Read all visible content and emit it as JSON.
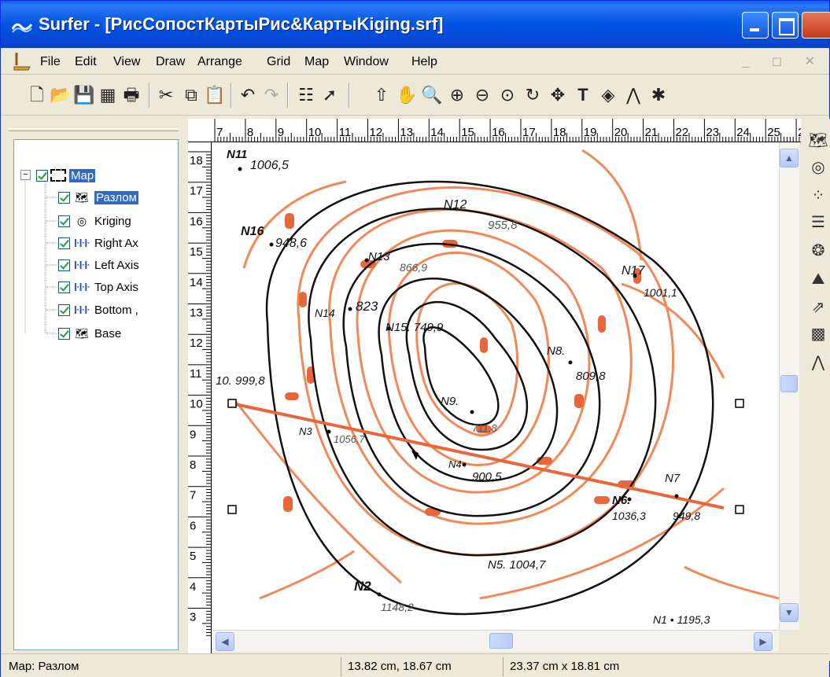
{
  "window": {
    "title": "Surfer - [РисСопостКартыРис&КартыKiging.srf]"
  },
  "menu": {
    "items": [
      {
        "label": "File"
      },
      {
        "label": "Edit"
      },
      {
        "label": "View"
      },
      {
        "label": "Draw"
      },
      {
        "label": "Arrange"
      },
      {
        "label": "Grid"
      },
      {
        "label": "Map"
      },
      {
        "label": "Window"
      },
      {
        "label": "Help"
      }
    ],
    "mdi_controls": "_ ◻ ✕"
  },
  "toolbar": {
    "icons": [
      "new-icon",
      "open-icon",
      "save-icon",
      "worksheet-icon",
      "print-icon",
      "cut-icon",
      "copy-icon",
      "paste-icon",
      "undo-icon",
      "redo-icon",
      "object-manager-icon",
      "help-pointer-icon",
      "select-icon",
      "pan-icon",
      "zoom-page-icon",
      "zoom-in-icon",
      "zoom-out-icon",
      "zoom-rect-icon",
      "rotate-icon",
      "trackball-icon",
      "text-icon",
      "polygon-icon",
      "polyline-icon",
      "symbol-icon"
    ]
  },
  "object_manager": {
    "items": [
      {
        "label": "Map",
        "level": 0,
        "icon": "map-frame-icon",
        "selected": true
      },
      {
        "label": "Разлом",
        "level": 1,
        "icon": "base-map-icon",
        "selected": true
      },
      {
        "label": "Kriging",
        "level": 1,
        "icon": "contour-map-icon",
        "selected": false
      },
      {
        "label": "Right Ax",
        "level": 1,
        "icon": "axis-icon",
        "selected": false
      },
      {
        "label": "Left Axis",
        "level": 1,
        "icon": "axis-icon",
        "selected": false
      },
      {
        "label": "Top Axis",
        "level": 1,
        "icon": "axis-icon",
        "selected": false
      },
      {
        "label": "Bottom ,",
        "level": 1,
        "icon": "axis-icon",
        "selected": false
      },
      {
        "label": "Base",
        "level": 1,
        "icon": "base-map-icon",
        "selected": false
      }
    ]
  },
  "ruler": {
    "horizontal": [
      "7",
      "8",
      "9",
      "10",
      "11",
      "12",
      "13",
      "14",
      "15",
      "16",
      "17",
      "18",
      "19",
      "20",
      "21",
      "22",
      "23",
      "24",
      "25",
      "2"
    ],
    "vertical": [
      "18",
      "17",
      "16",
      "15",
      "14",
      "13",
      "12",
      "11",
      "10",
      "9",
      "8",
      "7",
      "6",
      "5",
      "4",
      "3"
    ]
  },
  "map_labels": [
    {
      "id": "n11",
      "text": "N11"
    },
    {
      "id": "v1006",
      "text": "1006,5"
    },
    {
      "id": "n12",
      "text": "N12"
    },
    {
      "id": "v955",
      "text": "955,8"
    },
    {
      "id": "n16",
      "text": "N16"
    },
    {
      "id": "v948",
      "text": "948,6"
    },
    {
      "id": "n13",
      "text": "N13"
    },
    {
      "id": "v866",
      "text": "866,9"
    },
    {
      "id": "n17",
      "text": "N17"
    },
    {
      "id": "v1001",
      "text": "1001,1"
    },
    {
      "id": "n14",
      "text": "N14"
    },
    {
      "id": "v823",
      "text": "823"
    },
    {
      "id": "n15",
      "text": "N15. 749,9"
    },
    {
      "id": "n8",
      "text": "N8."
    },
    {
      "id": "v809",
      "text": "809,8"
    },
    {
      "id": "n10",
      "text": "10. 999,8"
    },
    {
      "id": "n9",
      "text": "N9."
    },
    {
      "id": "v711",
      "text": "711,8"
    },
    {
      "id": "n3",
      "text": "N3"
    },
    {
      "id": "v1056",
      "text": "1056,7"
    },
    {
      "id": "n4",
      "text": "N4"
    },
    {
      "id": "v900",
      "text": "900,5"
    },
    {
      "id": "n7",
      "text": "N7"
    },
    {
      "id": "n6",
      "text": "N6."
    },
    {
      "id": "v1036",
      "text": "1036,3"
    },
    {
      "id": "v949",
      "text": "949,8"
    },
    {
      "id": "n5",
      "text": "N5. 1004,7"
    },
    {
      "id": "n2",
      "text": "N2"
    },
    {
      "id": "v1148",
      "text": "1148,2"
    },
    {
      "id": "n1",
      "text": "N1 • 1195,3"
    }
  ],
  "status": {
    "selection": "Map: Разлом",
    "cursor": "13.82 cm, 18.67 cm",
    "size": "23.37 cm x 18.81 cm"
  },
  "colors": {
    "contour_black": "#111111",
    "contour_orange": "#F08858",
    "fault_line": "#E8663A",
    "selection": "#316AC5"
  }
}
